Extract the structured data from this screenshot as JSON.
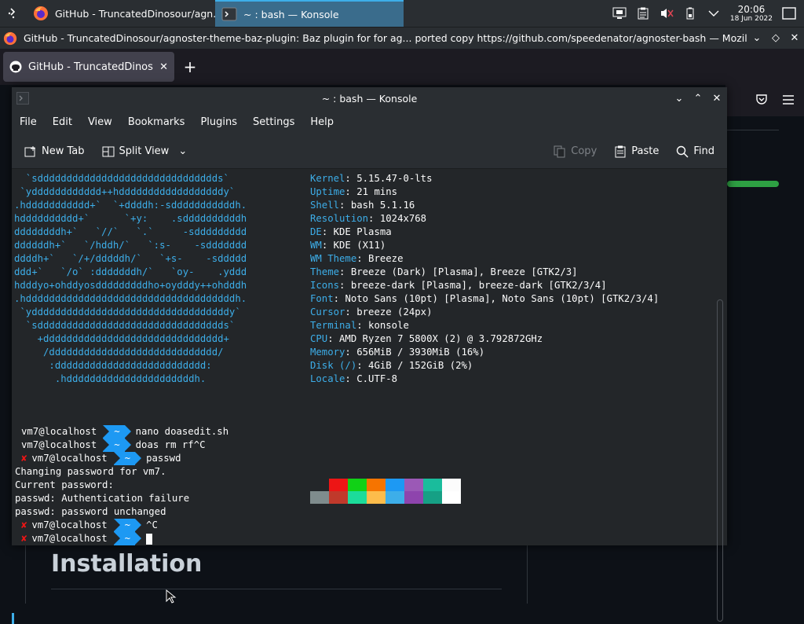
{
  "panel": {
    "tasks": [
      {
        "label": "GitHub - TruncatedDinosour/agn...",
        "icon": "firefox-icon"
      },
      {
        "label": "~ : bash — Konsole",
        "icon": "konsole-icon"
      }
    ],
    "clock": {
      "time": "20:06",
      "date": "18 Jun 2022"
    }
  },
  "firefox": {
    "window_title": "GitHub - TruncatedDinosour/agnoster-theme-baz-plugin: Baz plugin for for ag... ported copy https://github.com/speedenator/agnoster-bash — Mozilla Firefox",
    "tab_label": "GitHub - TruncatedDinosour",
    "page_heading": "Installation"
  },
  "konsole": {
    "title": "~ : bash — Konsole",
    "menu": [
      "File",
      "Edit",
      "View",
      "Bookmarks",
      "Plugins",
      "Settings",
      "Help"
    ],
    "toolbar": {
      "new_tab": "New Tab",
      "split_view": "Split View",
      "copy": "Copy",
      "paste": "Paste",
      "find": "Find"
    },
    "logo_lines": [
      "  `sddddddddddddddddddddddddddddddds`",
      " `ydddddddddddd++hddddddddddddddddddy`",
      ".hddddddddddd+`  `+ddddh:-sdddddddddddh.",
      "hdddddddddd+`      `+y:    .sddddddddddh",
      "ddddddddh+`   `//`   `.`     -sddddddddd",
      "ddddddh+`   `/hddh/`   `:s-    -sddddddd",
      "ddddh+`   `/+/dddddh/`   `+s-    -sddddd",
      "ddd+`   `/o` :dddddddh/`   `oy-    .yddd",
      "hdddyo+ohddyosdddddddddho+oydddy++ohdddh",
      ".hddddddddddddddddddddddddddddddddddddh.",
      " `yddddddddddddddddddddddddddddddddddy`",
      "  `sdddddddddddddddddddddddddddddddds`",
      "    +ddddddddddddddddddddddddddddddd+",
      "     /ddddddddddddddddddddddddddddd/",
      "      :dddddddddddddddddddddddddd:",
      "       .hddddddddddddddddddddddh."
    ],
    "info": [
      {
        "key": "Kernel",
        "value": "5.15.47-0-lts"
      },
      {
        "key": "Uptime",
        "value": "21 mins"
      },
      {
        "key": "Shell",
        "value": "bash 5.1.16"
      },
      {
        "key": "Resolution",
        "value": "1024x768"
      },
      {
        "key": "DE",
        "value": "KDE Plasma"
      },
      {
        "key": "WM",
        "value": "KDE (X11)"
      },
      {
        "key": "WM Theme",
        "value": "Breeze"
      },
      {
        "key": "Theme",
        "value": "Breeze (Dark) [Plasma], Breeze [GTK2/3]"
      },
      {
        "key": "Icons",
        "value": "breeze-dark [Plasma], breeze-dark [GTK2/3/4]"
      },
      {
        "key": "Font",
        "value": "Noto Sans (10pt) [Plasma], Noto Sans (10pt) [GTK2/3/4]"
      },
      {
        "key": "Cursor",
        "value": "breeze (24px)"
      },
      {
        "key": "Terminal",
        "value": "konsole"
      },
      {
        "key": "CPU",
        "value": "AMD Ryzen 7 5800X (2) @ 3.792872GHz"
      },
      {
        "key": "Memory",
        "value": "656MiB / 3930MiB (16%)"
      },
      {
        "key": "Disk (/)",
        "value": "4GiB / 152GiB (2%)"
      },
      {
        "key": "Locale",
        "value": "C.UTF-8"
      }
    ],
    "palette_top": [
      "#232629",
      "#ed1515",
      "#11d116",
      "#f67400",
      "#1d99f3",
      "#9b59b6",
      "#1abc9c",
      "#fcfcfc"
    ],
    "palette_bottom": [
      "#7f8c8d",
      "#c0392b",
      "#1cdc9a",
      "#fdbc4b",
      "#3daee9",
      "#8e44ad",
      "#16a085",
      "#ffffff"
    ],
    "prompt": {
      "user": "vm7@localhost",
      "dir": "~",
      "error_mark": "✘"
    },
    "session": [
      {
        "type": "prompt",
        "error": false,
        "cmd": "nano doasedit.sh"
      },
      {
        "type": "prompt",
        "error": false,
        "cmd": "doas rm rf^C"
      },
      {
        "type": "prompt",
        "error": true,
        "cmd": "passwd"
      },
      {
        "type": "output",
        "text": "Changing password for vm7."
      },
      {
        "type": "output",
        "text": "Current password:"
      },
      {
        "type": "output",
        "text": "passwd: Authentication failure"
      },
      {
        "type": "output",
        "text": "passwd: password unchanged"
      },
      {
        "type": "prompt",
        "error": true,
        "cmd": "^C"
      },
      {
        "type": "prompt",
        "error": true,
        "cmd": "",
        "cursor": true
      }
    ]
  }
}
